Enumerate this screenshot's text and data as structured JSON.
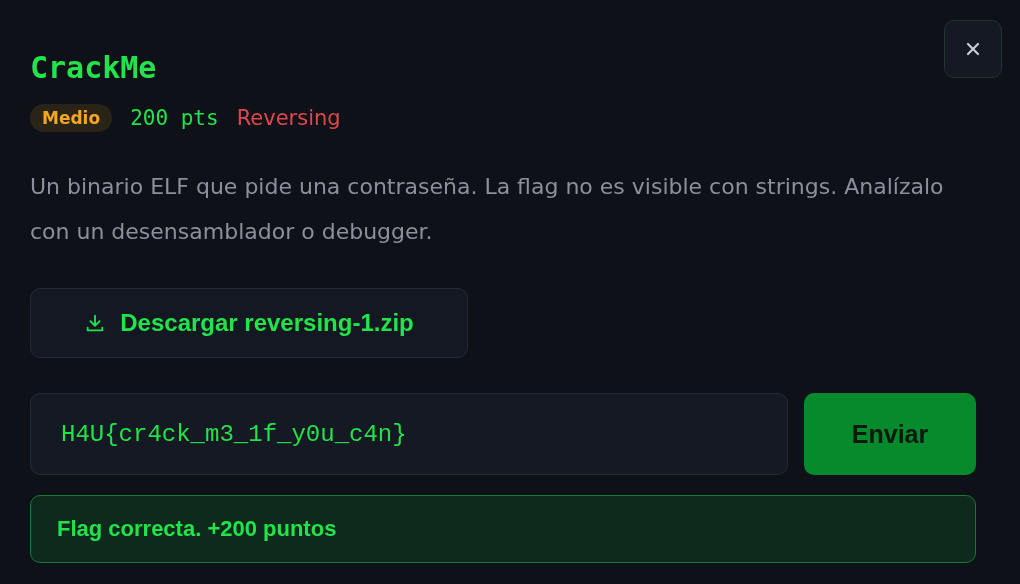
{
  "title": "CrackMe",
  "difficulty": {
    "label": "Medio"
  },
  "points": "200 pts",
  "category": "Reversing",
  "description": "Un binario ELF que pide una contraseña. La flag no es visible con strings. Analízalo con un desensamblador o debugger.",
  "download": {
    "label": "Descargar reversing-1.zip"
  },
  "flag_input": {
    "value": "H4U{cr4ck_m3_1f_y0u_c4n}"
  },
  "submit": {
    "label": "Enviar"
  },
  "result": {
    "kind": "success",
    "text": "Flag correcta. +200 puntos"
  }
}
